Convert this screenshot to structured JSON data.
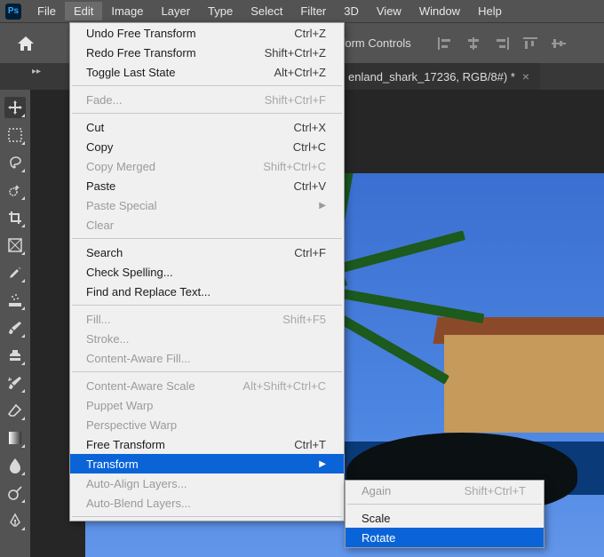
{
  "menubar": {
    "ps_label": "Ps",
    "items": [
      "File",
      "Edit",
      "Image",
      "Layer",
      "Type",
      "Select",
      "Filter",
      "3D",
      "View",
      "Window",
      "Help"
    ],
    "active_index": 1
  },
  "options_bar": {
    "label": "Transform Controls"
  },
  "document_tab": {
    "title_visible_fragment": "enland_shark_17236, RGB/8#) *"
  },
  "edit_menu": [
    {
      "label": "Undo Free Transform",
      "shortcut": "Ctrl+Z"
    },
    {
      "label": "Redo Free Transform",
      "shortcut": "Shift+Ctrl+Z"
    },
    {
      "label": "Toggle Last State",
      "shortcut": "Alt+Ctrl+Z"
    },
    {
      "sep": true
    },
    {
      "label": "Fade...",
      "shortcut": "Shift+Ctrl+F",
      "disabled": true
    },
    {
      "sep": true
    },
    {
      "label": "Cut",
      "shortcut": "Ctrl+X"
    },
    {
      "label": "Copy",
      "shortcut": "Ctrl+C"
    },
    {
      "label": "Copy Merged",
      "shortcut": "Shift+Ctrl+C",
      "disabled": true
    },
    {
      "label": "Paste",
      "shortcut": "Ctrl+V"
    },
    {
      "label": "Paste Special",
      "submenu": true,
      "disabled": true
    },
    {
      "label": "Clear",
      "disabled": true
    },
    {
      "sep": true
    },
    {
      "label": "Search",
      "shortcut": "Ctrl+F"
    },
    {
      "label": "Check Spelling..."
    },
    {
      "label": "Find and Replace Text..."
    },
    {
      "sep": true
    },
    {
      "label": "Fill...",
      "shortcut": "Shift+F5",
      "disabled": true
    },
    {
      "label": "Stroke...",
      "disabled": true
    },
    {
      "label": "Content-Aware Fill...",
      "disabled": true
    },
    {
      "sep": true
    },
    {
      "label": "Content-Aware Scale",
      "shortcut": "Alt+Shift+Ctrl+C",
      "disabled": true
    },
    {
      "label": "Puppet Warp",
      "disabled": true
    },
    {
      "label": "Perspective Warp",
      "disabled": true
    },
    {
      "label": "Free Transform",
      "shortcut": "Ctrl+T"
    },
    {
      "label": "Transform",
      "submenu": true,
      "highlight": true
    },
    {
      "label": "Auto-Align Layers...",
      "disabled": true
    },
    {
      "label": "Auto-Blend Layers...",
      "disabled": true
    },
    {
      "sep": true
    }
  ],
  "transform_submenu": [
    {
      "label": "Again",
      "shortcut": "Shift+Ctrl+T",
      "disabled": true
    },
    {
      "sep": true
    },
    {
      "label": "Scale"
    },
    {
      "label": "Rotate",
      "highlight": true
    }
  ],
  "tools": [
    "move-tool",
    "marquee-tool",
    "lasso-tool",
    "quick-selection-tool",
    "crop-tool",
    "frame-tool",
    "eyedropper-tool",
    "healing-brush-tool",
    "brush-tool",
    "clone-stamp-tool",
    "history-brush-tool",
    "eraser-tool",
    "gradient-tool",
    "blur-tool",
    "dodge-tool",
    "pen-tool"
  ]
}
